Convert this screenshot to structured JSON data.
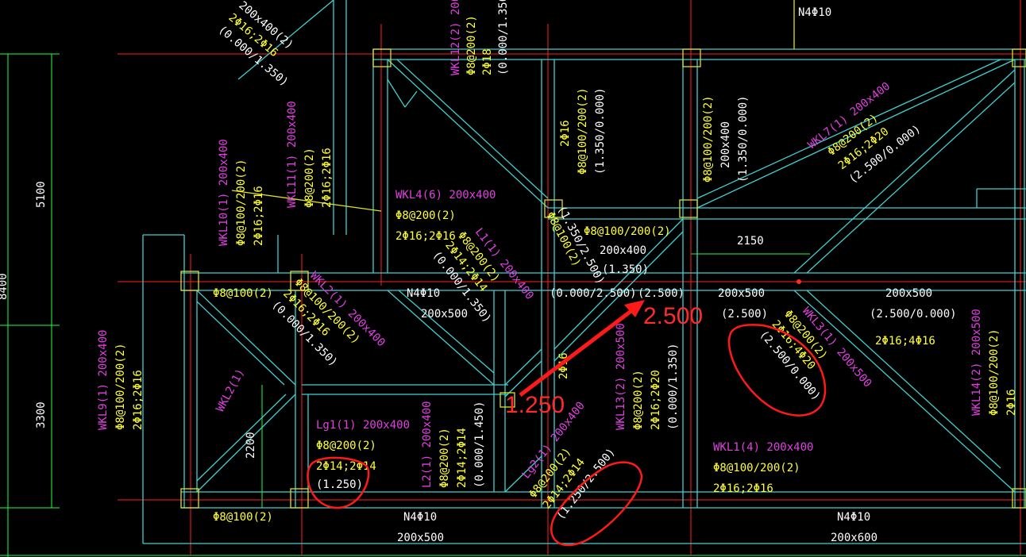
{
  "colors": {
    "background": "#000000",
    "beam_outline": "#40d0d0",
    "axis_line": "#ff2020",
    "dimension_line": "#20ff40",
    "beam_label": "#e040e0",
    "rebar_text": "#ffff33",
    "size_text": "#ffffff",
    "annotation": "#ff1a1a"
  },
  "dimensions": {
    "upper_bay": "5100",
    "lower_bay": "3300",
    "total_cut": "8400",
    "span_2150": "2150",
    "span_2200": "2200"
  },
  "beams": {
    "top_left_cut_a": "200x400(2)",
    "top_left_cut_b": "2Φ16;2Φ16",
    "top_left_cut_c": "(0.000/1.350)",
    "wkl12_name": "WKL12(2) 200x400",
    "wkl12_stir": "Φ8@200(2)",
    "wkl12_bars": "2Φ18",
    "wkl12_elev": "(0.000/1.350)",
    "top_right_n": "N4Φ10",
    "wkl11_name": "WKL11(1) 200x400",
    "wkl11_stir": "Φ8@200(2)",
    "wkl11_bars": "2Φ16;2Φ16",
    "wkl10_name": "WKL10(1) 200x400",
    "wkl10_stir": "Φ8@100/200(2)",
    "wkl10_bars": "2Φ16;2Φ16",
    "wkl4_name": "WKL4(6) 200x400",
    "wkl4_stir": "Φ8@200(2)",
    "wkl4_bars": "2Φ16;2Φ16",
    "mid_v_bars": "2Φ16",
    "mid_v_stir": "Φ8@100/200(2)",
    "mid_v_elev": "(1.350/0.000)",
    "right_v_stir": "Φ8@100/200(2)",
    "right_v_size": "200x400",
    "right_v_elev": "(1.350/0.000)",
    "wkl7_name": "WKL7(1) 200x400",
    "wkl7_stir": "Φ8@200(2)",
    "wkl7_bars": "2Φ16;2Φ20",
    "wkl7_elev": "(2.500/0.000)",
    "center_stir": "Φ8@100/200(2)",
    "center_size": "200x400",
    "center_elev": "(1.350)",
    "small_diag_stir": "Φ8@100(2)",
    "small_diag_elev": "(1.350/2.500)",
    "l1_name": "L1(1) 200x400",
    "l1_stir": "Φ8@200(2)",
    "l1_bars": "2Φ14;2Φ14",
    "l1_elev": "(0.000/1.350)",
    "left_stir_top": "Φ8@100(2)",
    "wkl2_name": "WKL2(1) 200x400",
    "wkl2_stir": "Φ8@100/200(2)",
    "wkl2_bars": "2Φ16;2Φ16",
    "wkl2_elev": "(0.000/1.350)",
    "mid_n": "N4Φ10",
    "mid_size": "200x500",
    "elev_a": "(0.000/2.500)",
    "elev_b": "(2.500)",
    "right_size_a": "200x500",
    "right_elev_a": "(2.500)",
    "right_size_b": "200x500",
    "right_elev_b": "(2.500/0.000)",
    "right_bars_b": "2Φ16;4Φ16",
    "wkl3_name": "WKL3(1) 200x500",
    "wkl3_stir": "Φ8@200(2)",
    "wkl3_bars": "2Φ16;4Φ20",
    "wkl3_elev": "(2.500/0.000)",
    "wkl14_name": "WKL14(2) 200x500",
    "wkl14_stir": "Φ8@100/200(2)",
    "wkl14_bars": "2Φ16",
    "wkl9_name": "WKL9(1) 200x400",
    "wkl9_stir": "Φ8@100/200(2)",
    "wkl9_bars": "2Φ16;2Φ16",
    "wkl2_small": "WKL2(1)",
    "lg1_name": "Lg1(1) 200x400",
    "lg1_stir": "Φ8@200(2)",
    "lg1_bars": "2Φ14;2Φ14",
    "lg1_elev": "(1.250)",
    "l2_name": "L2(1) 200x400",
    "l2_stir": "Φ8@200(2)",
    "l2_bars": "2Φ14;2Φ14",
    "l2_elev": "(0.000/1.450)",
    "v_2phi": "2Φ16",
    "wkl13_name": "WKL13(2) 200x500",
    "wkl13_stir": "Φ8@200(2)",
    "wkl13_bars": "2Φ16;2Φ20",
    "wkl13_elev": "(0.000/1.350)",
    "lg2_name": "Lg2(1) 200x400",
    "lg2_stir": "Φ8@200(2)",
    "lg2_bars": "2Φ14;2Φ14",
    "lg2_elev": "(1.250/2.500)",
    "wkl1_name": "WKL1(4) 200x400",
    "wkl1_stir": "Φ8@100/200(2)",
    "wkl1_bars": "2Φ16;2Φ16",
    "bottom_stir": "Φ8@100(2)",
    "bottom_n_a": "N4Φ10",
    "bottom_size_a": "200x500",
    "bottom_n_b": "N4Φ10",
    "bottom_size_b": "200x600"
  },
  "annotations": {
    "elev_high": "2.500",
    "elev_low": "1.250"
  }
}
